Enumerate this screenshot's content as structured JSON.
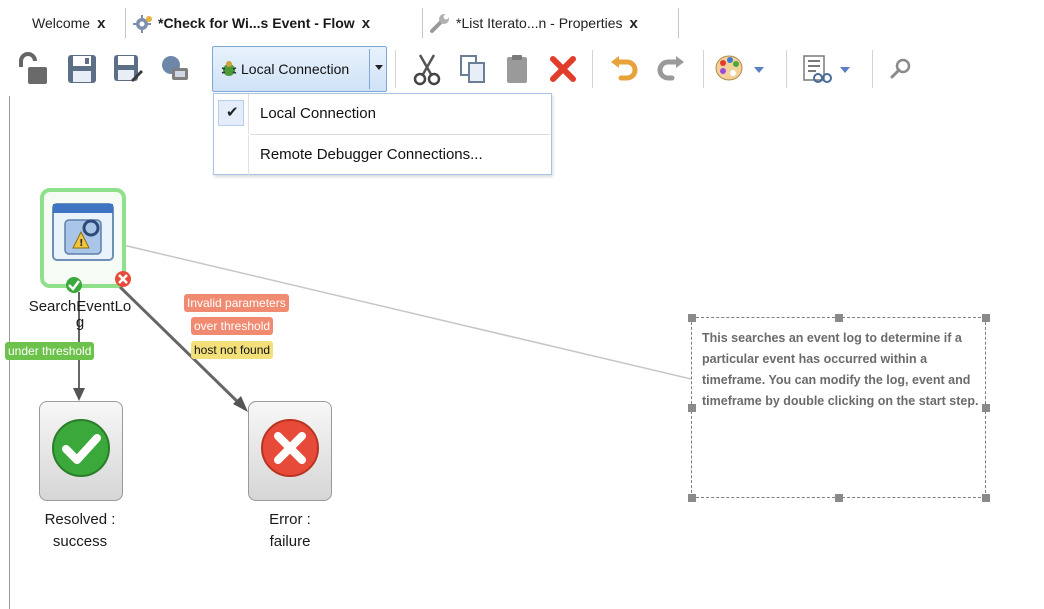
{
  "tabs": [
    {
      "label": "Welcome",
      "close": "x"
    },
    {
      "label": "*Check for Wi...s Event - Flow",
      "close": "x"
    },
    {
      "label": "*List Iterato...n - Properties",
      "close": "x"
    }
  ],
  "toolbar": {
    "connection_label": "Local Connection"
  },
  "connection_menu": {
    "items": [
      {
        "label": "Local Connection",
        "checked": true
      },
      {
        "label": "Remote Debugger Connections..."
      }
    ]
  },
  "flow": {
    "start_step": {
      "label_line1": "SearchEventLo",
      "label_line2": "g"
    },
    "resolved_step": {
      "label_line1": "Resolved :",
      "label_line2": "success"
    },
    "error_step": {
      "label_line1": "Error :",
      "label_line2": "failure"
    },
    "transition_tags": {
      "under_threshold": "under threshold",
      "invalid_parameters": "Invalid parameters",
      "over_threshold": "over threshold",
      "host_not_found": "host not found"
    },
    "note_text": "This searches an event log to determine if a particular event has occurred within a timeframe.  You can modify the log, event and timeframe by double clicking on the start step."
  },
  "colors": {
    "accent_blue": "#7ea7d8",
    "success_green": "#3aa83a",
    "error_red": "#e84a3a",
    "tag_green": "#6cc24a",
    "tag_salmon": "#f08a70",
    "tag_yellow": "#f3e07a",
    "selection_green": "#8fe08a"
  }
}
